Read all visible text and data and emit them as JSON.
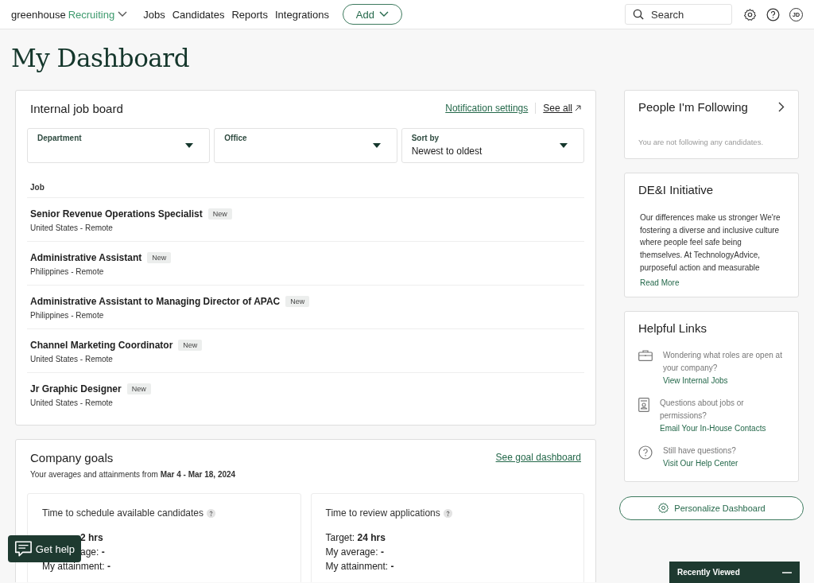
{
  "nav": {
    "brand": "greenhouse",
    "product": "Recruiting",
    "links": [
      "Jobs",
      "Candidates",
      "Reports",
      "Integrations"
    ],
    "add_button": "Add",
    "search": {
      "placeholder": "Search"
    },
    "avatar": "JD"
  },
  "page_title": "My Dashboard",
  "job_board": {
    "title": "Internal job board",
    "notification_link": "Notification settings",
    "see_all": "See all",
    "filters": [
      {
        "label": "Department"
      },
      {
        "label": "Office"
      },
      {
        "label": "Sort by",
        "value": "Newest to oldest"
      }
    ],
    "column": "Job",
    "jobs": [
      {
        "title": "Senior Revenue Operations Specialist",
        "badge": "New",
        "location": "United States - Remote"
      },
      {
        "title": "Administrative Assistant",
        "badge": "New",
        "location": "Philippines - Remote"
      },
      {
        "title": "Administrative Assistant to Managing Director of APAC",
        "badge": "New",
        "location": "Philippines - Remote"
      },
      {
        "title": "Channel Marketing Coordinator",
        "badge": "New",
        "location": "United States - Remote"
      },
      {
        "title": "Jr Graphic Designer",
        "badge": "New",
        "location": "United States - Remote"
      }
    ]
  },
  "goals": {
    "title": "Company goals",
    "link": "See goal dashboard",
    "subtitle": "Your averages and attainments from **Mar 4 - Mar 18, 2024**",
    "cards": [
      {
        "title": "Time to schedule available candidates",
        "lines": [
          {
            "kind": "cut",
            "text": "2 hrs",
            "bold": true
          },
          {
            "kind": "cut",
            "text": "age: **-**",
            "bold": false
          },
          {
            "kind": "full",
            "text": "My attainment: **-**",
            "bold": false
          }
        ]
      },
      {
        "title": "Time to review applications",
        "lines": [
          {
            "kind": "full",
            "text": "Target: **24 hrs**",
            "bold": false
          },
          {
            "kind": "full",
            "text": "My average: **-**",
            "bold": false
          },
          {
            "kind": "full",
            "text": "My attainment: **-**",
            "bold": false
          }
        ]
      }
    ]
  },
  "following": {
    "title": "People I'm Following",
    "empty": "You are not following any candidates."
  },
  "dei": {
    "title": "DE&I Initiative",
    "text": "Our differences make us stronger We're fostering a diverse and inclusive culture where people feel safe being themselves. At TechnologyAdvice, purposeful action and measurable",
    "link": "Read More"
  },
  "helpful_links": {
    "title": "Helpful Links",
    "items": [
      {
        "kind": "briefcase",
        "text": "Wondering what roles are open at your company?",
        "link": "View Internal Jobs"
      },
      {
        "kind": "contact",
        "text": "Questions about jobs or permissions?",
        "link": "Email Your In-House Contacts"
      },
      {
        "kind": "question",
        "text": "Still have questions?",
        "link": "Visit Our Help Center"
      }
    ]
  },
  "personalize_button": "Personalize Dashboard",
  "help_button": "Get help",
  "recently_viewed": "Recently Viewed"
}
